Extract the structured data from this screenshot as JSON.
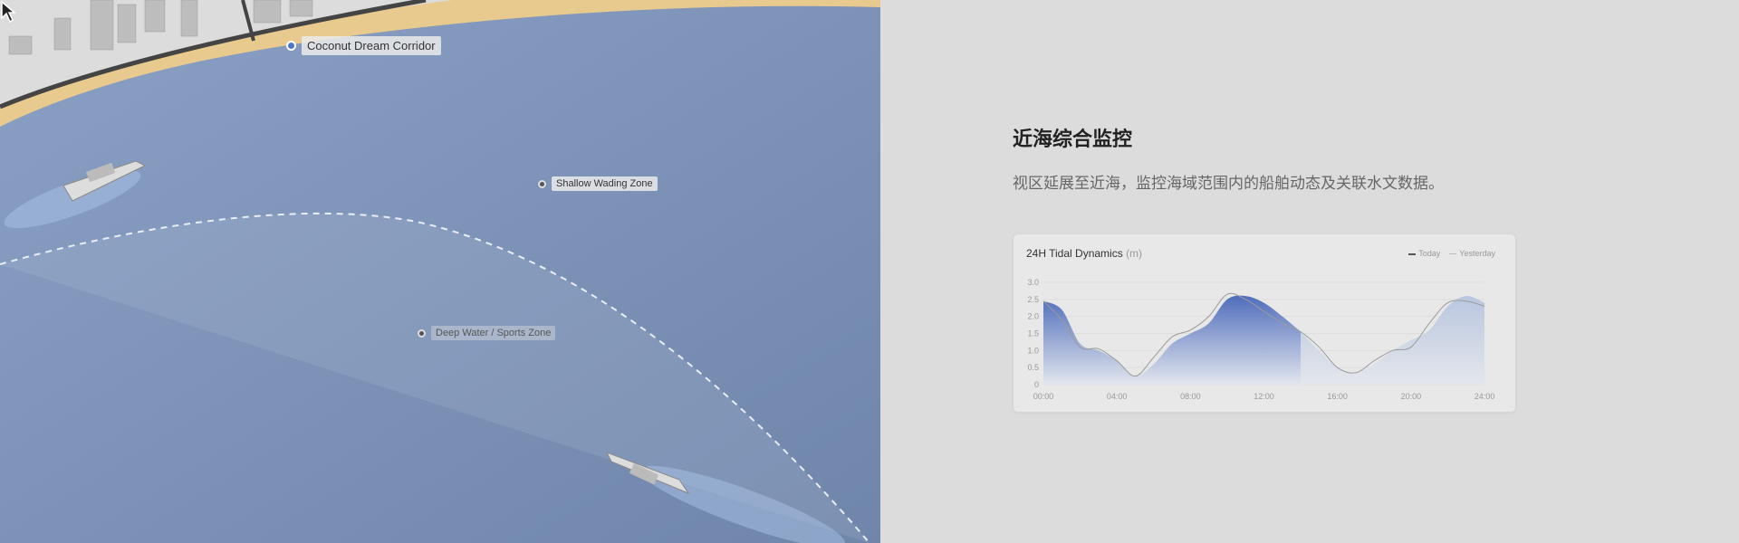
{
  "map": {
    "labels": {
      "corridor": "Coconut Dream Corridor",
      "shallow": "Shallow Wading Zone",
      "deep": "Deep Water / Sports Zone"
    }
  },
  "panel": {
    "title": "近海综合监控",
    "subtitle": "视区延展至近海，监控海域范围内的船舶动态及关联水文数据。"
  },
  "chart_data": {
    "type": "area",
    "title": "24H Tidal Dynamics",
    "unit": "(m)",
    "legend": [
      "Today",
      "Yesterday"
    ],
    "x": [
      0,
      1,
      2,
      3,
      4,
      5,
      6,
      7,
      8,
      9,
      10,
      11,
      12,
      13,
      14,
      15,
      16,
      17,
      18,
      19,
      20,
      21,
      22,
      23,
      24
    ],
    "xticks": [
      "00:00",
      "04:00",
      "08:00",
      "12:00",
      "16:00",
      "20:00",
      "24:00"
    ],
    "yticks": [
      "0",
      "0.5",
      "1.0",
      "1.5",
      "2.0",
      "2.5",
      "3.0"
    ],
    "ylim": [
      0,
      3
    ],
    "current_hour": 14,
    "series": [
      {
        "name": "Today",
        "color": "#5572b8",
        "values": [
          2.45,
          2.2,
          1.2,
          1.0,
          0.7,
          0.25,
          0.6,
          1.2,
          1.5,
          1.8,
          2.5,
          2.6,
          2.4,
          2.0,
          1.55,
          1.0,
          0.5,
          0.35,
          0.6,
          1.0,
          1.3,
          1.6,
          2.3,
          2.6,
          2.4
        ]
      },
      {
        "name": "Yesterday",
        "color": "#aaaaaa",
        "values": [
          2.45,
          1.9,
          1.1,
          1.05,
          0.7,
          0.25,
          0.8,
          1.4,
          1.6,
          2.0,
          2.65,
          2.5,
          2.15,
          1.8,
          1.55,
          1.1,
          0.5,
          0.35,
          0.7,
          1.0,
          1.1,
          1.8,
          2.4,
          2.45,
          2.3
        ]
      }
    ]
  }
}
